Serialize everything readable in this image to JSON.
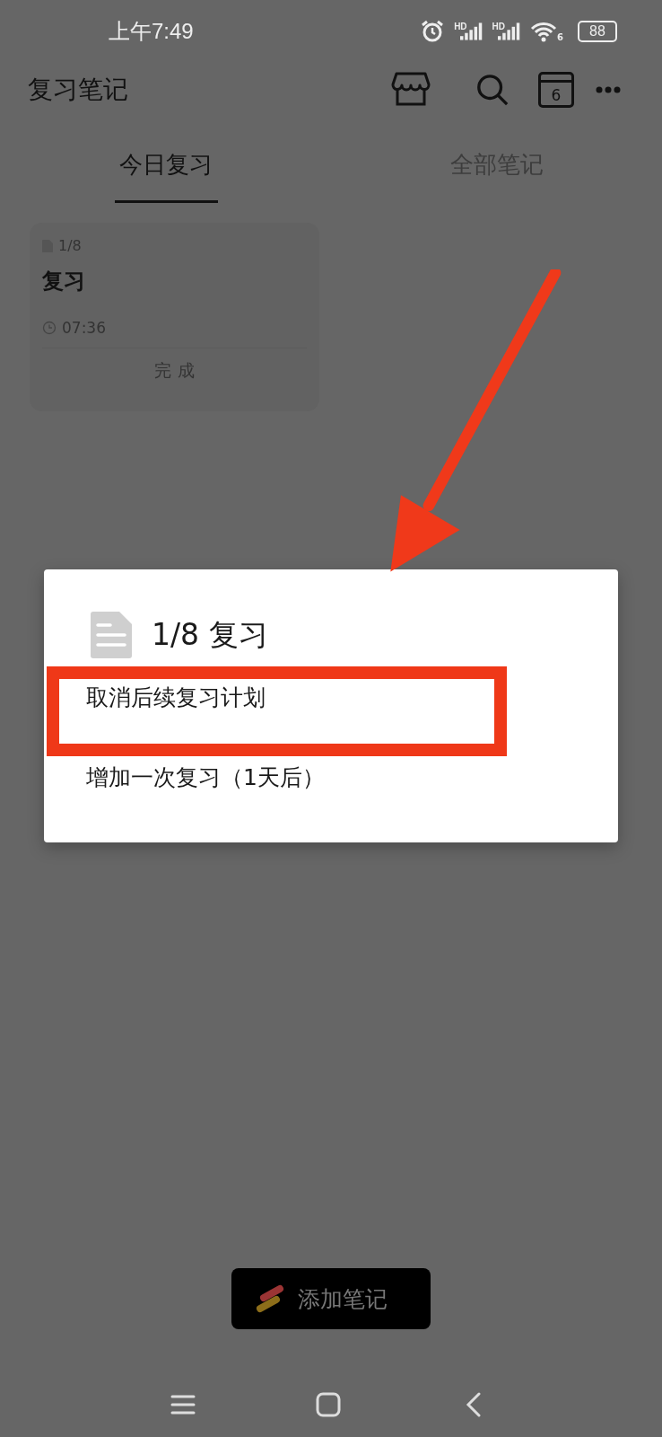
{
  "status_bar": {
    "time": "上午7:49",
    "signals": [
      {
        "label": "HD"
      },
      {
        "label": "HD"
      }
    ],
    "wifi_label": "6",
    "battery": "88"
  },
  "app_bar": {
    "title": "复习笔记",
    "calendar_day": "6"
  },
  "tabs": [
    {
      "label": "今日复习",
      "selected": true
    },
    {
      "label": "全部笔记",
      "selected": false
    }
  ],
  "cards": [
    {
      "counter": "1/8",
      "title": "复习",
      "time": "07:36",
      "action": "完 成"
    }
  ],
  "dialog": {
    "title": "1/8 复习",
    "items": [
      {
        "label": "取消后续复习计划",
        "highlighted": true
      },
      {
        "label": "增加一次复习（1天后）",
        "highlighted": false
      }
    ]
  },
  "add_button": {
    "label": "添加笔记"
  }
}
